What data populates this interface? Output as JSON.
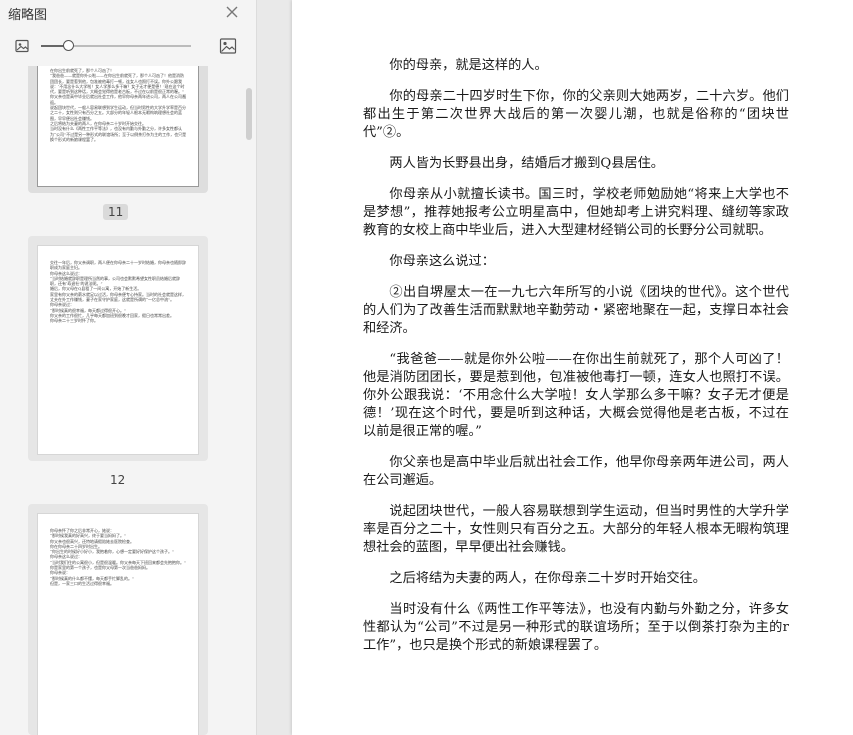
{
  "sidebar": {
    "title": "缩略图",
    "icons": {
      "close": "close-icon",
      "zoom_out": "image-small-icon",
      "zoom_in": "image-large-icon"
    },
    "zoom_level": 0.18,
    "thumbnails": [
      {
        "label": "11",
        "selected": true,
        "text": "在你出生前就死了，那个人可凶了！\n“我爸爸——就是你外公啦——在你出生前就死了，那个人可凶了！他是消防团团长，要是惹到他，包准被他毒打一顿，连女人也照打不误。你外公跟我说：‘不用念什么大学啦！女人学那么多干嘛？女子无才便是德！’现在这个时代，要是听到这种话，大概会觉得他是老古板，不过在以前是很正常的喔。”\n你父亲也是高中毕业后就出社会工作，他早你母亲两年进公司，两人在公司邂逅。\n说起团块世代，一般人容易联想到学生运动，但当时男性的大学升学率是百分之二十，女性则只有百分之五。大部分的年轻人根本无暇构筑理想社会的蓝图，早早便出社会赚钱。\n之后将结为夫妻的两人，在你母亲二十岁时开始交往。\n当时没有什么《两性工作平等法》，也没有内勤与外勤之分，许多女性都认为“公司”不过是另一种形式的联谊场所；至于以倒茶打杂为主的工作，也只是换个形式的新娘课程罢了。"
      },
      {
        "label": "12",
        "selected": false,
        "text": "交往一年后，你父亲调职，两人便在你母亲二十一岁时结婚，你母亲也随即辞职成为家庭主妇。\n你母亲这么说过：\n“当时结婚就辞职是理所当然的事，公司也会默默希望女性职员结婚后就辞职，还有‘寿退社’的说法呢。”\n婚后，你父母在Q县租了一间公寓，开始了新生活。\n家里有你父亲的薪水就足以过活，你母亲便专心持家。当时的社会就是这样，丈夫在外工作赚钱，妻子在家守护家庭，这就是所谓的“一亿总中流”。\n你母亲说过：\n“那时候真的很幸福，每天都过得很开心。”\n你父亲的工作很忙，几乎每天都加班到很晚才回家，假日也常常出差。\n你母亲二十三岁时怀了你。"
      },
      {
        "label": "",
        "selected": false,
        "text": "你母亲怀了你之后非常开心，她说：\n“那时候我真的好高兴，终于要当妈妈了。”\n你父亲也很高兴，还特地请假陪她去医院检查。\n你在你母亲二十四岁时出生。\n“你出生的时候好小好小，我抱着你，心想一定要好好保护这个孩子。”\n你母亲这么说过：\n“当时我们住的公寓很小，但是很温暖。你父亲每天下班回来都会先抱抱你。”\n你是家里的第一个孩子，也是你父母第一次当爸爸妈妈。\n你母亲说：\n“那时候真的什么都不懂，每天都手忙脚乱的。”\n但是，一家三口的生活过得很幸福。"
      }
    ]
  },
  "document": {
    "paragraphs": [
      "你的母亲，就是这样的人。",
      "你的母亲二十四岁时生下你，你的父亲则大她两岁，二十六岁。他们都出生于第二次世界大战后的第一次婴儿潮，也就是俗称的“团块世代”②。",
      "两人皆为长野县出身，结婚后才搬到Q县居住。",
      "你母亲从小就擅长读书。国三时，学校老师勉励她“将来上大学也不是梦想”，推荐她报考公立明星高中，但她却考上讲究料理、缝纫等家政教育的女校上商中毕业后，进入大型建材经销公司的长野分公司就职。",
      "你母亲这么说过：",
      "②出自堺屋太一在一九七六年所写的小说《团块的世代》。这个世代的人们为了改善生活而默默地辛勤劳动・紧密地聚在一起，支撑日本社会和经济。",
      "“我爸爸——就是你外公啦——在你出生前就死了，那个人可凶了！他是消防团团长，要是惹到他，包准被他毒打一顿，连女人也照打不误。你外公跟我说：‘不用念什么大学啦！女人学那么多干嘛？女子无才便是德！’现在这个时代，要是听到这种话，大概会觉得他是老古板，不过在以前是很正常的喔。”",
      "你父亲也是高中毕业后就出社会工作，他早你母亲两年进公司，两人在公司邂逅。",
      "说起团块世代，一般人容易联想到学生运动，但当时男性的大学升学率是百分之二十，女性则只有百分之五。大部分的年轻人根本无暇构筑理想社会的蓝图，早早便出社会赚钱。",
      "之后将结为夫妻的两人，在你母亲二十岁时开始交往。",
      "当时没有什么《两性工作平等法》，也没有内勤与外勤之分，许多女性都认为“公司”不过是另一种形式的联谊场所；至于以倒茶打杂为主的r工作”，也只是换个形式的新娘课程罢了。"
    ]
  }
}
